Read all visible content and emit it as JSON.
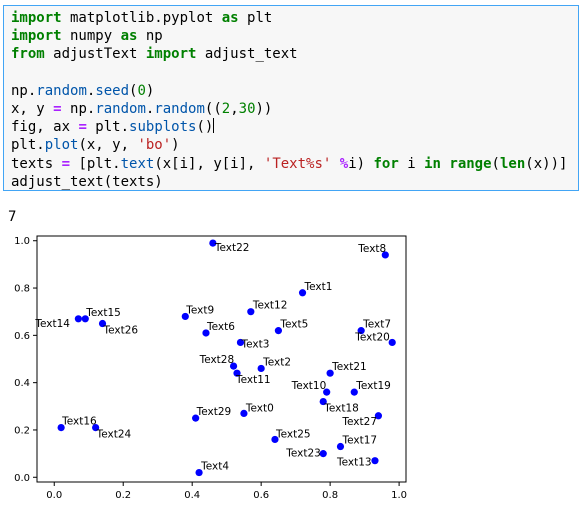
{
  "code_cell": {
    "lines": [
      [
        {
          "t": "import",
          "c": "kw"
        },
        {
          "t": " matplotlib.pyplot ",
          "c": ""
        },
        {
          "t": "as",
          "c": "kw"
        },
        {
          "t": " plt",
          "c": ""
        }
      ],
      [
        {
          "t": "import",
          "c": "kw"
        },
        {
          "t": " numpy ",
          "c": ""
        },
        {
          "t": "as",
          "c": "kw"
        },
        {
          "t": " np",
          "c": ""
        }
      ],
      [
        {
          "t": "from",
          "c": "kw"
        },
        {
          "t": " adjustText ",
          "c": ""
        },
        {
          "t": "import",
          "c": "kw"
        },
        {
          "t": " adjust_text",
          "c": ""
        }
      ],
      [],
      [
        {
          "t": "np.",
          "c": ""
        },
        {
          "t": "random",
          "c": "fn"
        },
        {
          "t": ".",
          "c": ""
        },
        {
          "t": "seed",
          "c": "fn"
        },
        {
          "t": "(",
          "c": ""
        },
        {
          "t": "0",
          "c": "num"
        },
        {
          "t": ")",
          "c": ""
        }
      ],
      [
        {
          "t": "x, y ",
          "c": ""
        },
        {
          "t": "=",
          "c": "op"
        },
        {
          "t": " np.",
          "c": ""
        },
        {
          "t": "random",
          "c": "fn"
        },
        {
          "t": ".",
          "c": ""
        },
        {
          "t": "random",
          "c": "fn"
        },
        {
          "t": "((",
          "c": ""
        },
        {
          "t": "2",
          "c": "num"
        },
        {
          "t": ",",
          "c": ""
        },
        {
          "t": "30",
          "c": "num"
        },
        {
          "t": "))",
          "c": ""
        }
      ],
      [
        {
          "t": "fig, ax ",
          "c": ""
        },
        {
          "t": "=",
          "c": "op"
        },
        {
          "t": " plt.",
          "c": ""
        },
        {
          "t": "subplots",
          "c": "fn"
        },
        {
          "t": "()",
          "c": ""
        },
        {
          "t": "",
          "c": "cursor"
        }
      ],
      [
        {
          "t": "plt.",
          "c": ""
        },
        {
          "t": "plot",
          "c": "fn"
        },
        {
          "t": "(x, y, ",
          "c": ""
        },
        {
          "t": "'bo'",
          "c": "str"
        },
        {
          "t": ")",
          "c": ""
        }
      ],
      [
        {
          "t": "texts ",
          "c": ""
        },
        {
          "t": "=",
          "c": "op"
        },
        {
          "t": " [plt.",
          "c": ""
        },
        {
          "t": "text",
          "c": "fn"
        },
        {
          "t": "(x[i], y[i], ",
          "c": ""
        },
        {
          "t": "'Text%s'",
          "c": "str"
        },
        {
          "t": " ",
          "c": ""
        },
        {
          "t": "%",
          "c": "op"
        },
        {
          "t": "i) ",
          "c": ""
        },
        {
          "t": "for",
          "c": "kw"
        },
        {
          "t": " i ",
          "c": ""
        },
        {
          "t": "in",
          "c": "kw"
        },
        {
          "t": " ",
          "c": ""
        },
        {
          "t": "range",
          "c": "kw2"
        },
        {
          "t": "(",
          "c": ""
        },
        {
          "t": "len",
          "c": "kw2"
        },
        {
          "t": "(x))]",
          "c": ""
        }
      ],
      [
        {
          "t": "adjust_text(texts)",
          "c": ""
        }
      ]
    ]
  },
  "output_text": "7",
  "colors": {
    "marker": "#0000ff",
    "cell_border": "#42a5f5",
    "cell_bg": "#f7f7f7"
  },
  "chart_data": {
    "type": "scatter",
    "xlim": [
      -0.05,
      1.02
    ],
    "ylim": [
      -0.02,
      1.02
    ],
    "xticks": [
      "0.0",
      "0.2",
      "0.4",
      "0.6",
      "0.8",
      "1.0"
    ],
    "xtick_values": [
      0.0,
      0.2,
      0.4,
      0.6,
      0.8,
      1.0
    ],
    "yticks": [
      "0.0",
      "0.2",
      "0.4",
      "0.6",
      "0.8",
      "1.0"
    ],
    "ytick_values": [
      0.0,
      0.2,
      0.4,
      0.6,
      0.8,
      1.0
    ],
    "grid": false,
    "marker": "bo",
    "points": [
      {
        "label": "Text0",
        "x": 0.55,
        "y": 0.27
      },
      {
        "label": "Text1",
        "x": 0.72,
        "y": 0.78
      },
      {
        "label": "Text2",
        "x": 0.6,
        "y": 0.46
      },
      {
        "label": "Text3",
        "x": 0.54,
        "y": 0.57
      },
      {
        "label": "Text4",
        "x": 0.42,
        "y": 0.02
      },
      {
        "label": "Text5",
        "x": 0.65,
        "y": 0.62
      },
      {
        "label": "Text6",
        "x": 0.44,
        "y": 0.61
      },
      {
        "label": "Text7",
        "x": 0.89,
        "y": 0.62
      },
      {
        "label": "Text8",
        "x": 0.96,
        "y": 0.94
      },
      {
        "label": "Text9",
        "x": 0.38,
        "y": 0.68
      },
      {
        "label": "Text10",
        "x": 0.79,
        "y": 0.36
      },
      {
        "label": "Text11",
        "x": 0.53,
        "y": 0.44
      },
      {
        "label": "Text12",
        "x": 0.57,
        "y": 0.7
      },
      {
        "label": "Text13",
        "x": 0.93,
        "y": 0.07
      },
      {
        "label": "Text14",
        "x": 0.07,
        "y": 0.67
      },
      {
        "label": "Text15",
        "x": 0.09,
        "y": 0.67
      },
      {
        "label": "Text16",
        "x": 0.02,
        "y": 0.21
      },
      {
        "label": "Text17",
        "x": 0.83,
        "y": 0.13
      },
      {
        "label": "Text18",
        "x": 0.78,
        "y": 0.32
      },
      {
        "label": "Text19",
        "x": 0.87,
        "y": 0.36
      },
      {
        "label": "Text20",
        "x": 0.98,
        "y": 0.57
      },
      {
        "label": "Text21",
        "x": 0.8,
        "y": 0.44
      },
      {
        "label": "Text22",
        "x": 0.46,
        "y": 0.99
      },
      {
        "label": "Text23",
        "x": 0.78,
        "y": 0.1
      },
      {
        "label": "Text24",
        "x": 0.12,
        "y": 0.21
      },
      {
        "label": "Text25",
        "x": 0.64,
        "y": 0.16
      },
      {
        "label": "Text26",
        "x": 0.14,
        "y": 0.65
      },
      {
        "label": "Text27",
        "x": 0.94,
        "y": 0.26
      },
      {
        "label": "Text28",
        "x": 0.52,
        "y": 0.47
      },
      {
        "label": "Text29",
        "x": 0.41,
        "y": 0.25
      }
    ]
  }
}
